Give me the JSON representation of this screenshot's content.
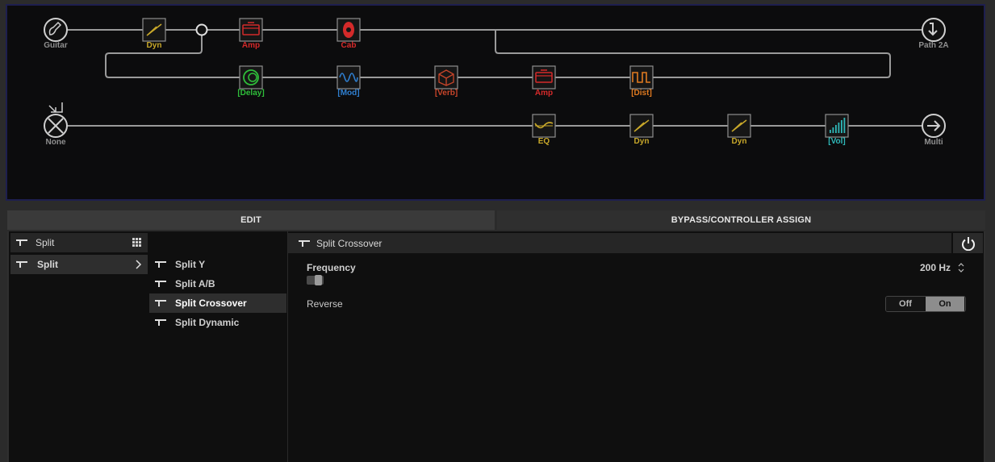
{
  "colors": {
    "dyn": "#c8a82a",
    "amp": "#d42a2a",
    "cab": "#d42a2a",
    "delay": "#2fbf3a",
    "mod": "#2f7fd0",
    "verb": "#c8452a",
    "dist": "#e07a20",
    "eq": "#c8a82a",
    "vol": "#2fb8b8",
    "io": "#bdbdbd"
  },
  "chain": {
    "input_top": "Guitar",
    "output_top": "Path 2A",
    "input_bottom": "None",
    "output_bottom": "Multi",
    "row1": [
      {
        "label": "Dyn",
        "icon": "dynamics-icon",
        "color": "dyn"
      },
      {
        "label": "Amp",
        "icon": "amp-icon",
        "color": "amp"
      },
      {
        "label": "Cab",
        "icon": "cab-icon",
        "color": "cab"
      }
    ],
    "row2": [
      {
        "label": "[Delay]",
        "icon": "delay-icon",
        "color": "delay"
      },
      {
        "label": "[Mod]",
        "icon": "mod-icon",
        "color": "mod"
      },
      {
        "label": "[Verb]",
        "icon": "reverb-icon",
        "color": "verb"
      },
      {
        "label": "Amp",
        "icon": "amp-icon",
        "color": "amp"
      },
      {
        "label": "[Dist]",
        "icon": "distortion-icon",
        "color": "dist"
      }
    ],
    "row3": [
      {
        "label": "EQ",
        "icon": "eq-icon",
        "color": "eq"
      },
      {
        "label": "Dyn",
        "icon": "dynamics-icon",
        "color": "dyn"
      },
      {
        "label": "Dyn",
        "icon": "dynamics-icon",
        "color": "dyn"
      },
      {
        "label": "[Vol]",
        "icon": "volume-icon",
        "color": "vol"
      }
    ]
  },
  "tabs": {
    "edit": "EDIT",
    "bypass": "BYPASS/CONTROLLER ASSIGN"
  },
  "category": {
    "header": "Split",
    "selected": "Split"
  },
  "models": [
    "Split Y",
    "Split A/B",
    "Split Crossover",
    "Split Dynamic"
  ],
  "selected_model": "Split Crossover",
  "params": {
    "title": "Split Crossover",
    "frequency_label": "Frequency",
    "frequency_value": "200 Hz",
    "reverse_label": "Reverse",
    "reverse_off": "Off",
    "reverse_on": "On",
    "reverse_state": "On"
  }
}
